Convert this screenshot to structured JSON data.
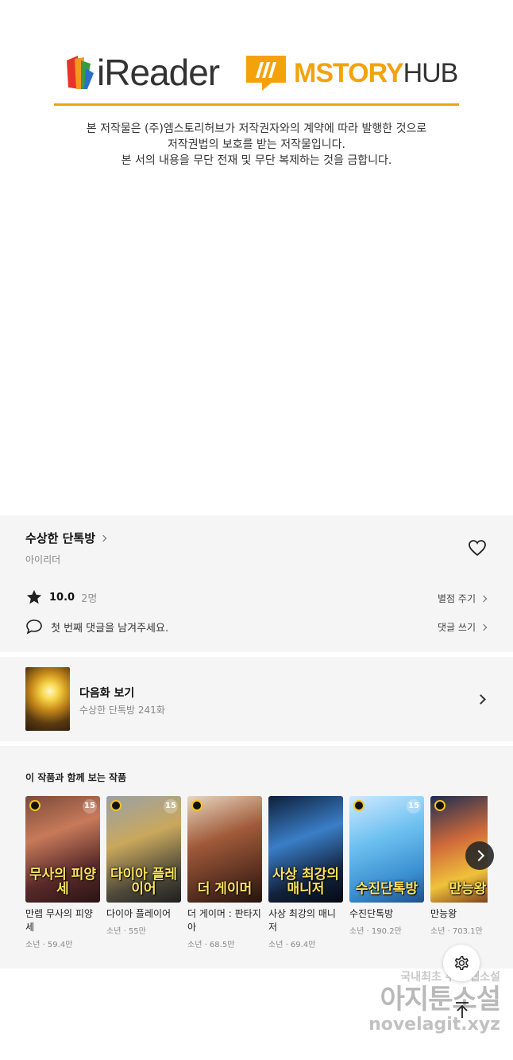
{
  "banner": {
    "ireader_label": "iReader",
    "mstory_label_a": "MSTORY",
    "mstory_label_b": "HUB",
    "copyright_lines": [
      "본 저작물은 (주)엠스토리허브가 저작권자와의 계약에 따라 발행한 것으로",
      "저작권법의 보호를 받는 저작물입니다.",
      "본 서의 내용을 무단 전재 및 무단 복제하는 것을 금합니다."
    ],
    "accent_color": "#f4a20c"
  },
  "work": {
    "title": "수상한 단톡방",
    "author": "아이리더",
    "rating": "10.0",
    "rating_count": "2명",
    "rate_link": "별점 주기",
    "comment_prompt": "첫 번째 댓글을 남겨주세요.",
    "comment_link": "댓글 쓰기"
  },
  "next_episode": {
    "title": "다음화 보기",
    "subtitle": "수상한 단톡방 241화"
  },
  "recommendations": {
    "heading": "이 작품과 함께 보는 작품",
    "items": [
      {
        "name": "만렙 무사의 피양세",
        "meta": "소년 · 59.4만",
        "cover_text": "무사의 피양세",
        "age": "15"
      },
      {
        "name": "다이아 플레이어",
        "meta": "소년 · 55만",
        "cover_text": "다이아 플레이어",
        "age": "15"
      },
      {
        "name": "더 게이머 : 판타지아",
        "meta": "소년 · 68.5만",
        "cover_text": "더 게이머",
        "age": ""
      },
      {
        "name": "사상 최강의 매니저",
        "meta": "소년 · 69.4만",
        "cover_text": "사상 최강의 매니저",
        "age": ""
      },
      {
        "name": "수진단톡방",
        "meta": "소년 · 190.2만",
        "cover_text": "수진단톡방",
        "age": "15"
      },
      {
        "name": "만능왕",
        "meta": "소년 · 703.1만",
        "cover_text": "만능왕",
        "age": ""
      }
    ]
  },
  "watermark": {
    "line1": "국내최초 무료 웹소설",
    "line2": "아지툰소설",
    "line3": "novelagit.xyz"
  },
  "icons": [
    "heart-icon",
    "star-icon",
    "comment-icon",
    "chevron-right-icon",
    "settings-icon",
    "scroll-top-icon",
    "clock-icon"
  ]
}
